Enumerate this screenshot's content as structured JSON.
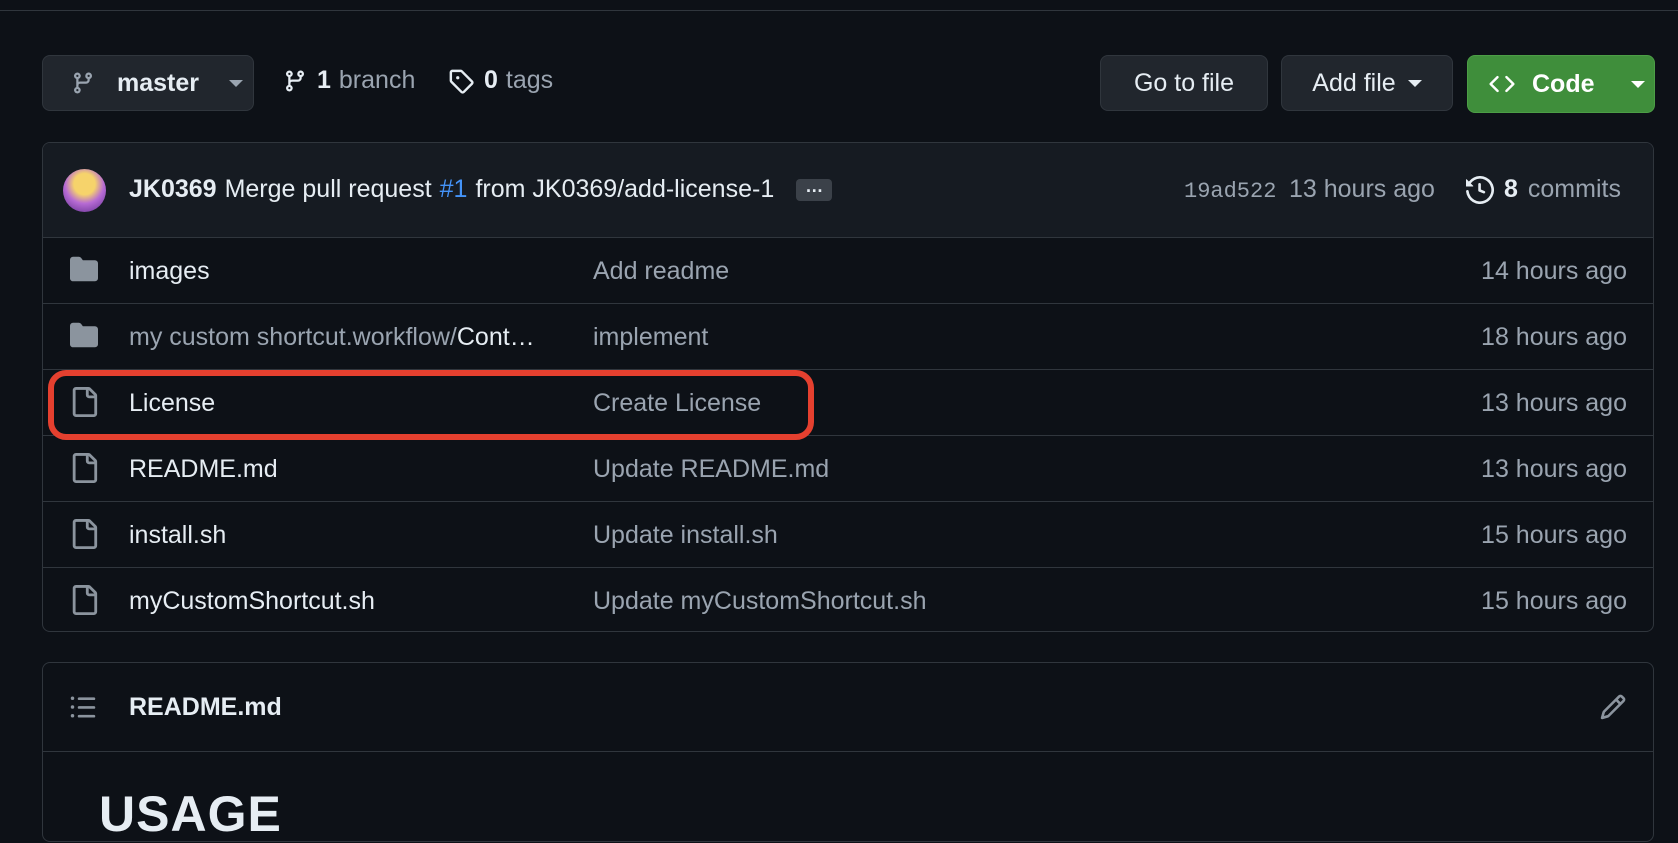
{
  "toolbar": {
    "branch_label": "master",
    "branches_count": "1",
    "branches_label": "branch",
    "tags_count": "0",
    "tags_label": "tags",
    "goto_label": "Go to file",
    "addfile_label": "Add file",
    "code_label": "Code",
    "code_color": "#3f8e3b"
  },
  "commit": {
    "author": "JK0369",
    "message_prefix": "Merge pull request",
    "pr_ref": "#1",
    "message_suffix": "from JK0369/add-license-1",
    "ellipsis": "…",
    "sha": "19ad522",
    "time": "13 hours ago",
    "commits_count": "8",
    "commits_label": "commits"
  },
  "files": [
    {
      "icon": "folder-icon",
      "name": "images",
      "name_dim": "",
      "message": "Add readme",
      "time": "14 hours ago"
    },
    {
      "icon": "folder-icon",
      "name_dim": "my custom shortcut.workflow/",
      "name": "Cont…",
      "message": "implement",
      "time": "18 hours ago"
    },
    {
      "icon": "file-icon",
      "name": "License",
      "name_dim": "",
      "message": "Create License",
      "time": "13 hours ago"
    },
    {
      "icon": "file-icon",
      "name": "README.md",
      "name_dim": "",
      "message": "Update README.md",
      "time": "13 hours ago"
    },
    {
      "icon": "file-icon",
      "name": "install.sh",
      "name_dim": "",
      "message": "Update install.sh",
      "time": "15 hours ago"
    },
    {
      "icon": "file-icon",
      "name": "myCustomShortcut.sh",
      "name_dim": "",
      "message": "Update myCustomShortcut.sh",
      "time": "15 hours ago"
    }
  ],
  "highlight_color": "#e5402f",
  "readme": {
    "title": "README.md",
    "heading": "USAGE"
  }
}
